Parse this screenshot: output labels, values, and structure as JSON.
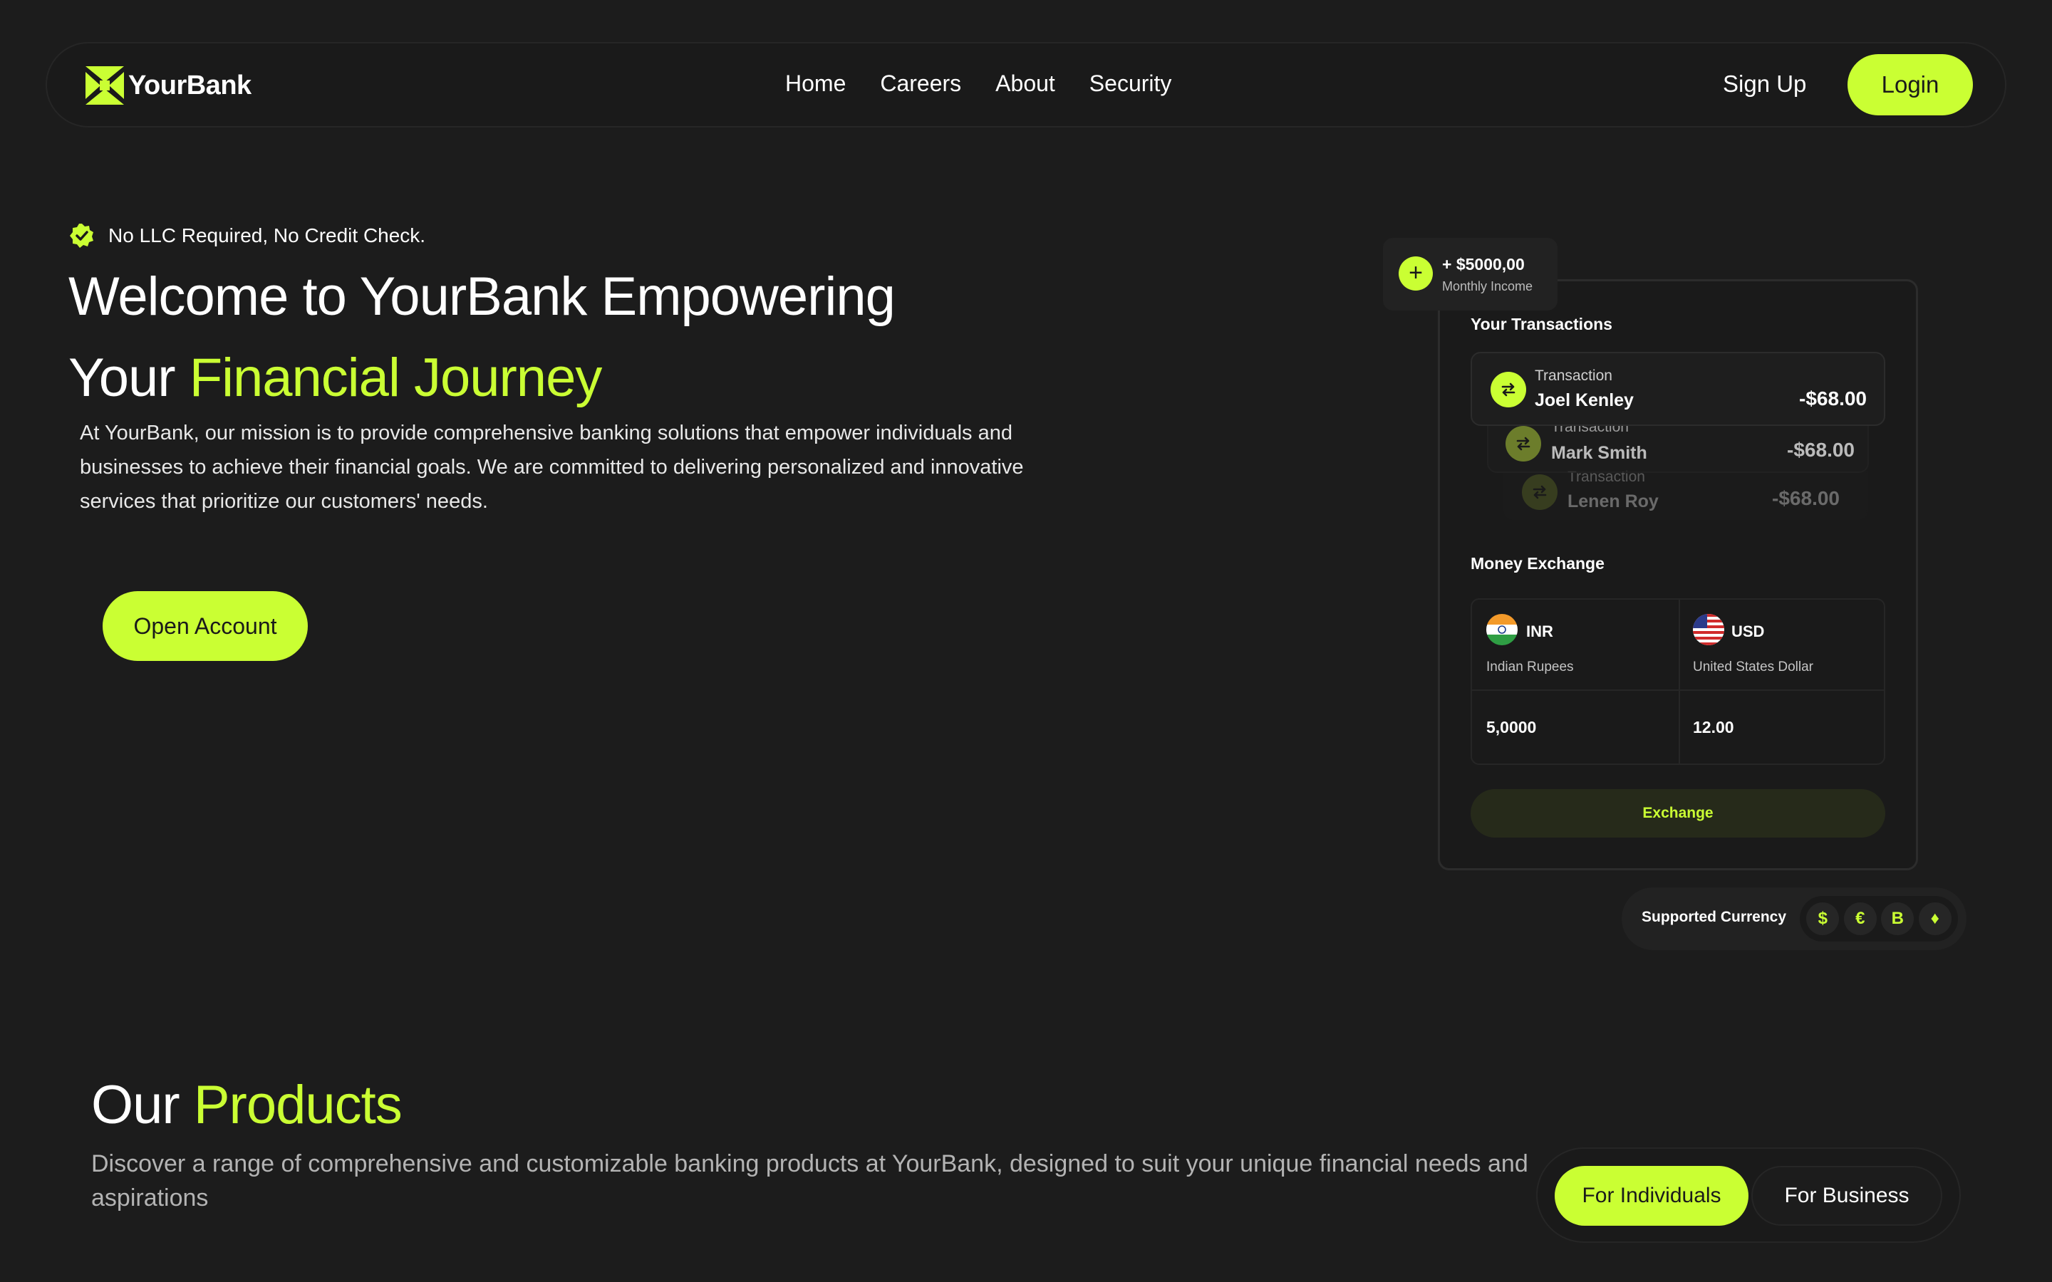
{
  "brand": {
    "name": "YourBank",
    "accent_color": "#caff33",
    "logo_icon": "yourbank-logo-icon"
  },
  "nav": {
    "links": [
      "Home",
      "Careers",
      "About",
      "Security"
    ],
    "signup": "Sign Up",
    "login": "Login"
  },
  "hero": {
    "badge": "No LLC Required, No Credit Check.",
    "title_line1": "Welcome to YourBank Empowering",
    "title_line2_plain": "Your ",
    "title_line2_accent": "Financial Journey",
    "description": "At YourBank, our mission is to provide comprehensive banking solutions that empower individuals and businesses to achieve their financial goals. We are committed to delivering personalized and innovative services that prioritize our customers' needs.",
    "cta": "Open Account"
  },
  "widget": {
    "income": {
      "amount": "+ $5000,00",
      "label": "Monthly Income"
    },
    "transactions_title": "Your Transactions",
    "transactions": [
      {
        "label": "Transaction",
        "name": "Joel Kenley",
        "amount": "-$68.00"
      },
      {
        "label": "Transaction",
        "name": "Mark Smith",
        "amount": "-$68.00"
      },
      {
        "label": "Transaction",
        "name": "Lenen Roy",
        "amount": "-$68.00"
      }
    ],
    "exchange_title": "Money Exchange",
    "exchange": {
      "from": {
        "code": "INR",
        "name": "Indian Rupees",
        "value": "5,0000"
      },
      "to": {
        "code": "USD",
        "name": "United States Dollar",
        "value": "12.00"
      }
    },
    "exchange_button": "Exchange",
    "supported_currency": {
      "label": "Supported Currency",
      "symbols": [
        "$",
        "€",
        "B",
        "♦"
      ]
    }
  },
  "products": {
    "title_plain": "Our ",
    "title_accent": "Products",
    "description": "Discover a range of comprehensive and customizable banking products at YourBank, designed to suit your unique financial needs and aspirations",
    "tabs": [
      "For Individuals",
      "For Business"
    ]
  }
}
